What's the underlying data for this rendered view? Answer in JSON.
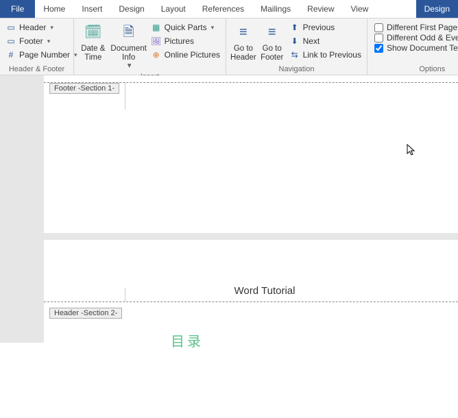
{
  "tabs": {
    "file": "File",
    "home": "Home",
    "insert": "Insert",
    "design": "Design",
    "layout": "Layout",
    "references": "References",
    "mailings": "Mailings",
    "review": "Review",
    "view": "View",
    "design_tool": "Design"
  },
  "hf_group": {
    "header": "Header",
    "footer": "Footer",
    "page_number": "Page Number",
    "label": "Header & Footer"
  },
  "dt_group": {
    "date_time": "Date & Time",
    "doc_info": "Document Info"
  },
  "insert_group": {
    "quick_parts": "Quick Parts",
    "pictures": "Pictures",
    "online_pictures": "Online Pictures",
    "label": "Insert"
  },
  "nav_group": {
    "goto_header": "Go to Header",
    "goto_footer": "Go to Footer",
    "previous": "Previous",
    "next": "Next",
    "link_prev": "Link to Previous",
    "label": "Navigation"
  },
  "options_group": {
    "diff_first": "Different First Page",
    "diff_odd_even": "Different Odd & Even Pages",
    "show_doc_text": "Show Document Text",
    "label": "Options"
  },
  "doc": {
    "footer_tag": "Footer -Section 1-",
    "header_tag": "Header -Section 2-",
    "header_text": "Word Tutorial",
    "toc_text": "目录"
  }
}
